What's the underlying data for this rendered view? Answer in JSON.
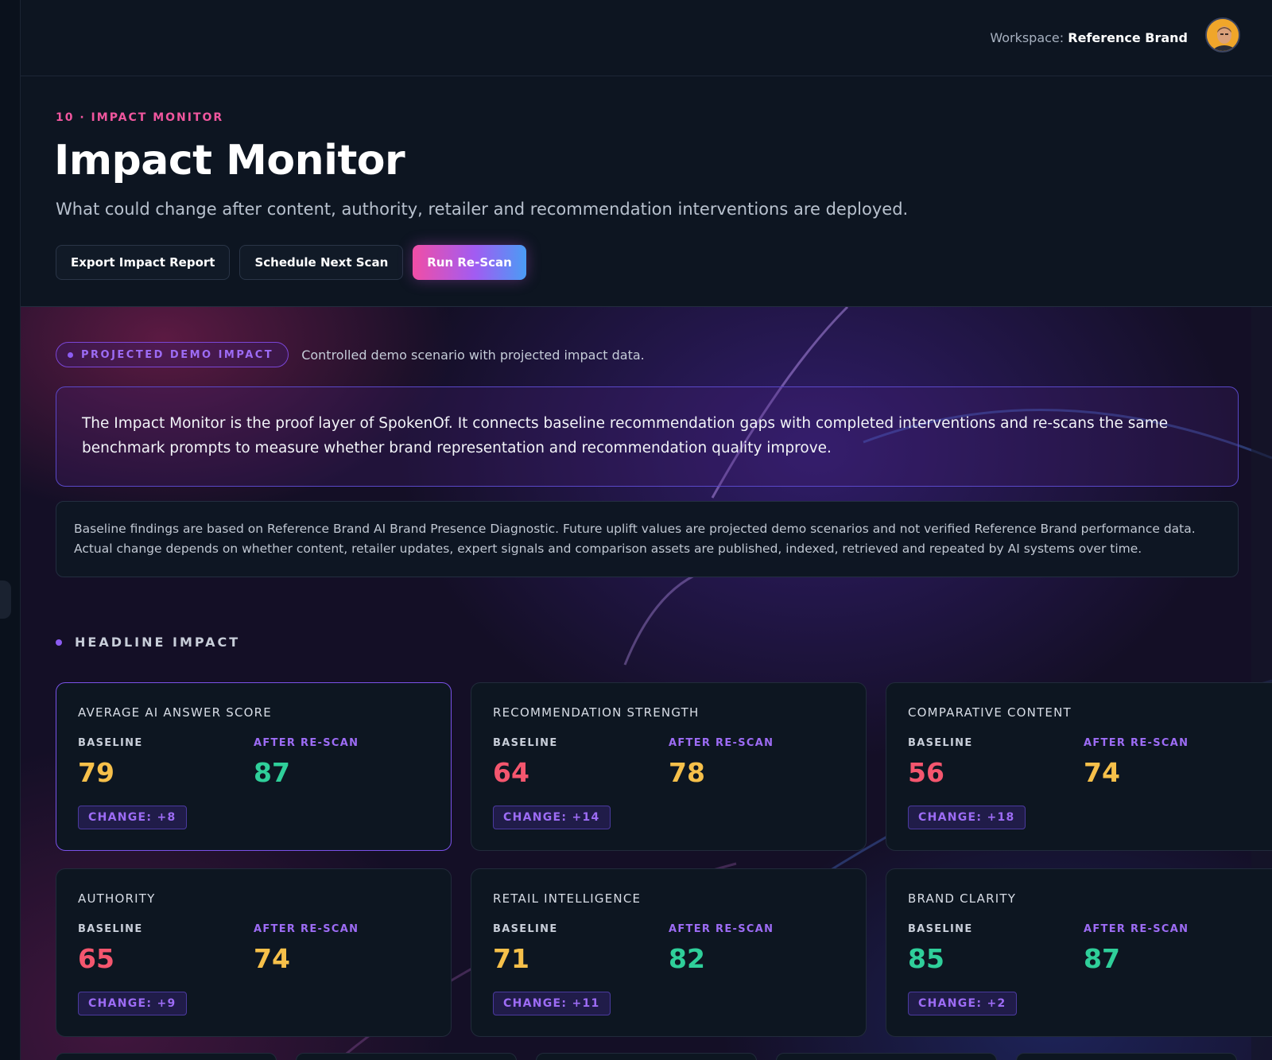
{
  "topbar": {
    "workspace_label": "Workspace:",
    "workspace_name": "Reference Brand"
  },
  "header": {
    "eyebrow": "10 · IMPACT MONITOR",
    "title": "Impact Monitor",
    "subtitle": "What could change after content, authority, retailer and recommendation interventions are deployed.",
    "buttons": {
      "export": "Export Impact Report",
      "schedule": "Schedule Next Scan",
      "rescan": "Run Re-Scan"
    }
  },
  "tag": {
    "pill": "PROJECTED DEMO IMPACT",
    "note": "Controlled demo scenario with projected impact data."
  },
  "intro": "The Impact Monitor is the proof layer of SpokenOf. It connects baseline recommendation gaps with completed interventions and re-scans the same benchmark prompts to measure whether brand representation and recommendation quality improve.",
  "disclaimer": "Baseline findings are based on Reference Brand AI Brand Presence Diagnostic. Future uplift values are projected demo scenarios and not verified Reference Brand performance data. Actual change depends on whether content, retailer updates, expert signals and comparison assets are published, indexed, retrieved and repeated by AI systems over time.",
  "section_label": "HEADLINE IMPACT",
  "col_labels": {
    "baseline": "BASELINE",
    "after": "AFTER RE-SCAN"
  },
  "colors": {
    "yellow": "#f6c04a",
    "green": "#2fcf9a",
    "red": "#f4566e",
    "accent": "#9d6cf5",
    "pink": "#f0569e"
  },
  "cards": [
    {
      "title": "AVERAGE AI ANSWER SCORE",
      "baseline": "79",
      "after": "87",
      "change": "CHANGE: +8",
      "baseline_color": "yellow",
      "after_color": "green"
    },
    {
      "title": "RECOMMENDATION STRENGTH",
      "baseline": "64",
      "after": "78",
      "change": "CHANGE: +14",
      "baseline_color": "red",
      "after_color": "yellow"
    },
    {
      "title": "COMPARATIVE CONTENT",
      "baseline": "56",
      "after": "74",
      "change": "CHANGE: +18",
      "baseline_color": "red",
      "after_color": "yellow"
    },
    {
      "title": "AUTHORITY",
      "baseline": "65",
      "after": "74",
      "change": "CHANGE: +9",
      "baseline_color": "red",
      "after_color": "yellow"
    },
    {
      "title": "RETAIL INTELLIGENCE",
      "baseline": "71",
      "after": "82",
      "change": "CHANGE: +11",
      "baseline_color": "yellow",
      "after_color": "green"
    },
    {
      "title": "BRAND CLARITY",
      "baseline": "85",
      "after": "87",
      "change": "CHANGE: +2",
      "baseline_color": "green",
      "after_color": "green"
    }
  ]
}
